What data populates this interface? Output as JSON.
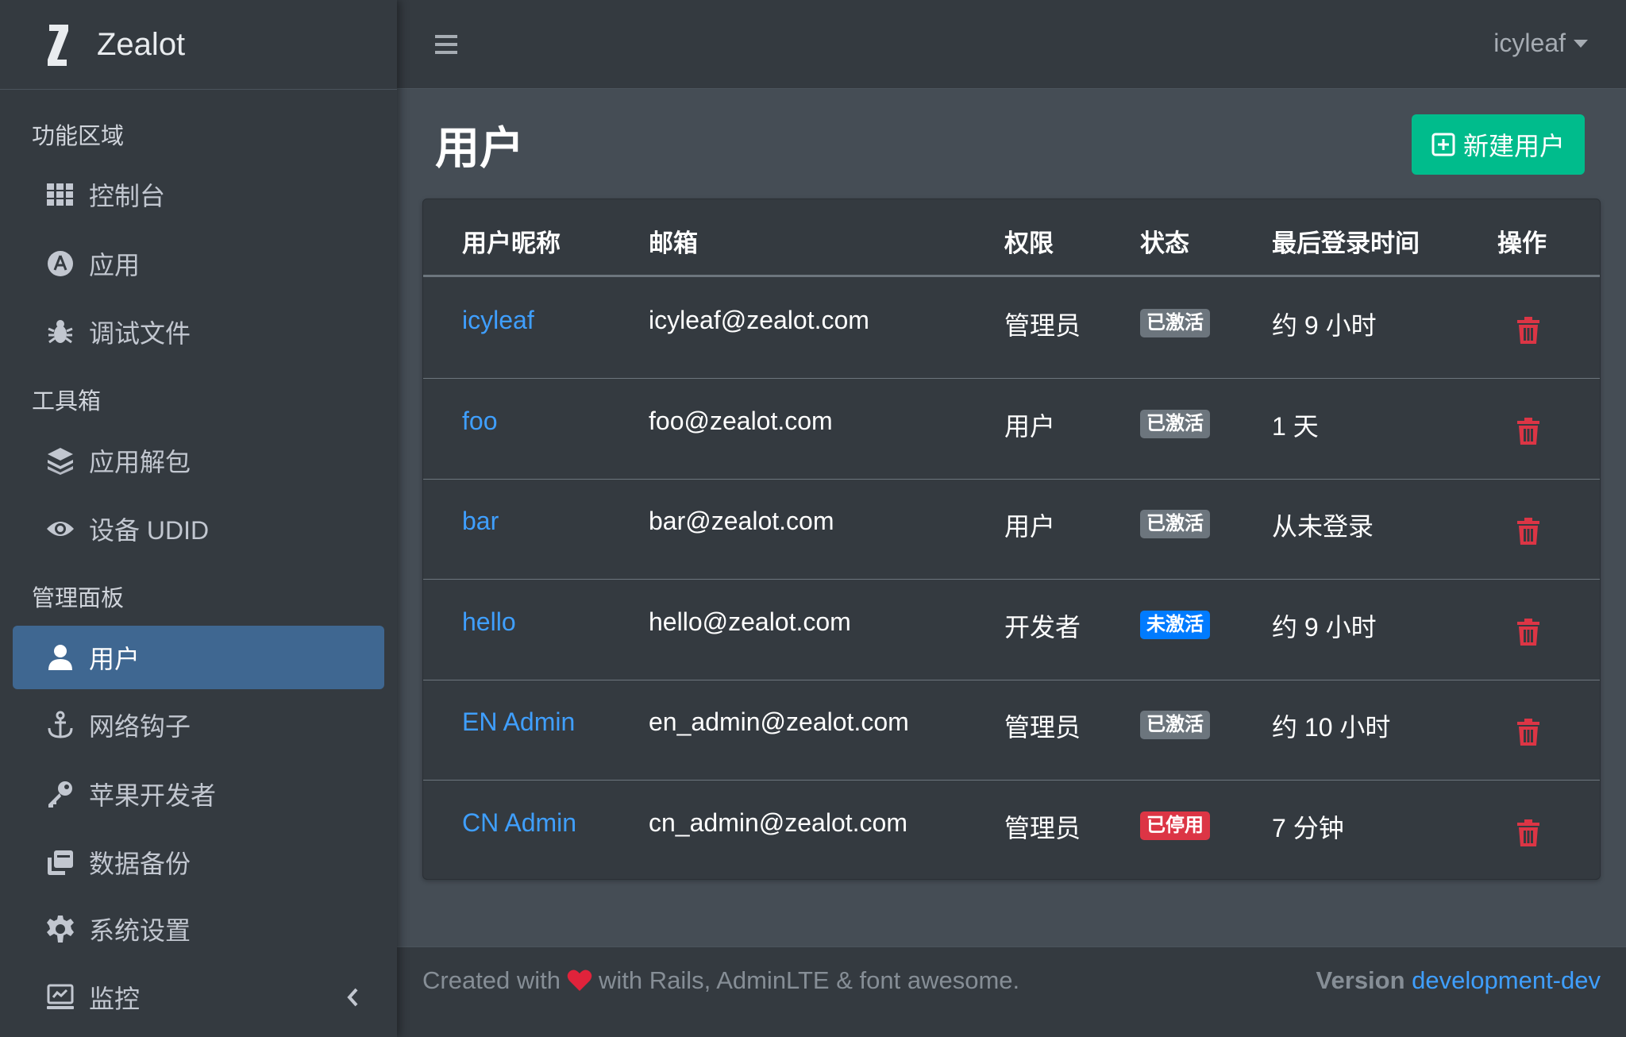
{
  "brand": {
    "name": "Zealot"
  },
  "sidebar": {
    "sections": [
      {
        "header": "功能区域"
      },
      {
        "header": "工具箱"
      },
      {
        "header": "管理面板"
      }
    ],
    "items": [
      {
        "label": "控制台",
        "icon": "grid-icon"
      },
      {
        "label": "应用",
        "icon": "app-store-icon"
      },
      {
        "label": "调试文件",
        "icon": "bug-icon"
      },
      {
        "label": "应用解包",
        "icon": "layers-icon"
      },
      {
        "label": "设备 UDID",
        "icon": "eye-icon"
      },
      {
        "label": "用户",
        "icon": "user-icon",
        "active": true
      },
      {
        "label": "网络钩子",
        "icon": "anchor-icon"
      },
      {
        "label": "苹果开发者",
        "icon": "key-icon"
      },
      {
        "label": "数据备份",
        "icon": "clone-icon"
      },
      {
        "label": "系统设置",
        "icon": "gear-icon"
      },
      {
        "label": "监控",
        "icon": "monitor-icon"
      }
    ]
  },
  "topbar": {
    "user": "icyleaf"
  },
  "main": {
    "title": "用户",
    "new_button": "新建用户",
    "table": {
      "headers": [
        "用户昵称",
        "邮箱",
        "权限",
        "状态",
        "最后登录时间",
        "操作"
      ],
      "rows": [
        {
          "name": "icyleaf",
          "email": "icyleaf@zealot.com",
          "role": "管理员",
          "status": "已激活",
          "status_color": "#6c757d",
          "last_login": "约 9 小时"
        },
        {
          "name": "foo",
          "email": "foo@zealot.com",
          "role": "用户",
          "status": "已激活",
          "status_color": "#6c757d",
          "last_login": "1 天"
        },
        {
          "name": "bar",
          "email": "bar@zealot.com",
          "role": "用户",
          "status": "已激活",
          "status_color": "#6c757d",
          "last_login": "从未登录"
        },
        {
          "name": "hello",
          "email": "hello@zealot.com",
          "role": "开发者",
          "status": "未激活",
          "status_color": "#007bff",
          "last_login": "约 9 小时"
        },
        {
          "name": "EN Admin",
          "email": "en_admin@zealot.com",
          "role": "管理员",
          "status": "已激活",
          "status_color": "#6c757d",
          "last_login": "约 10 小时"
        },
        {
          "name": "CN Admin",
          "email": "cn_admin@zealot.com",
          "role": "管理员",
          "status": "已停用",
          "status_color": "#dc3545",
          "last_login": "7 分钟"
        }
      ]
    }
  },
  "footer": {
    "created_prefix": "Created with",
    "created_suffix": "with Rails, AdminLTE & font awesome.",
    "version_label": "Version",
    "version_value": "development-dev"
  },
  "colors": {
    "accent_green": "#00bc8c",
    "link_blue": "#3f9fff",
    "danger_red": "#dc3545"
  }
}
